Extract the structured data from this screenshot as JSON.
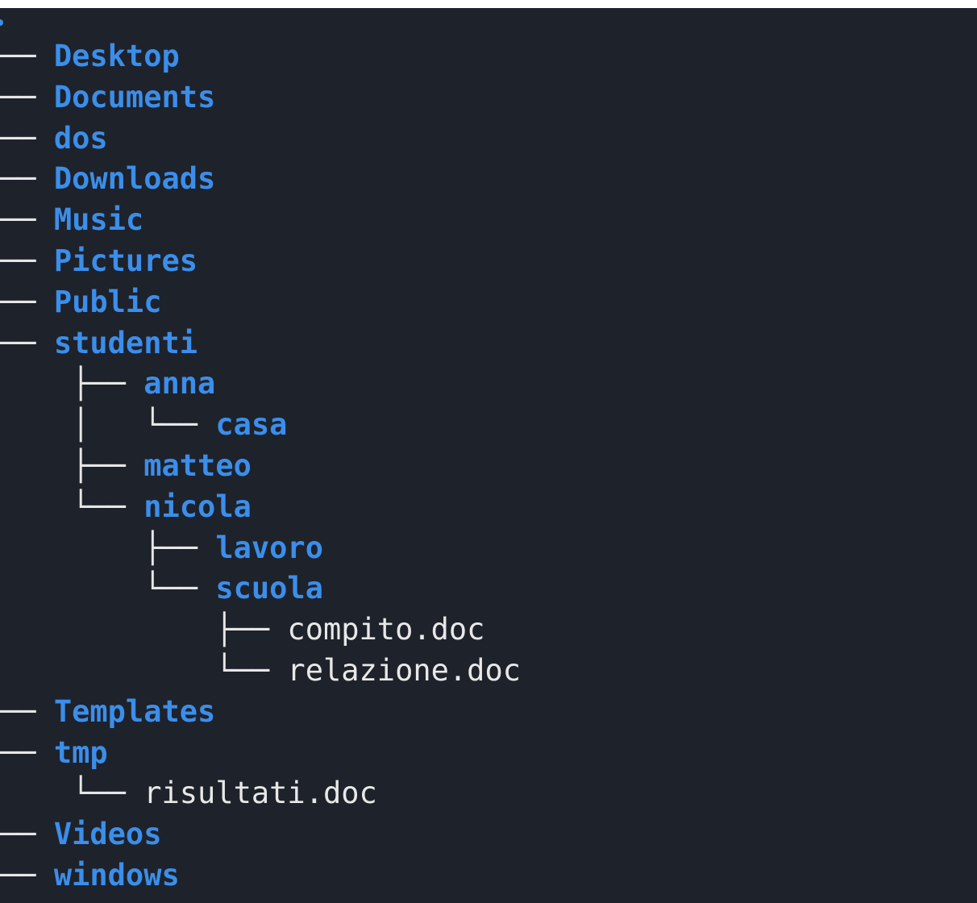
{
  "window": {
    "title": ""
  },
  "colors": {
    "background": "#1e222b",
    "directory": "#3b8eea",
    "file": "#e8e8e8",
    "tree_lines": "#e6e6e6"
  },
  "tree": [
    {
      "prefix": "── ",
      "name": "Desktop",
      "type": "dir"
    },
    {
      "prefix": "── ",
      "name": "Documents",
      "type": "dir"
    },
    {
      "prefix": "── ",
      "name": "dos",
      "type": "dir"
    },
    {
      "prefix": "── ",
      "name": "Downloads",
      "type": "dir"
    },
    {
      "prefix": "── ",
      "name": "Music",
      "type": "dir"
    },
    {
      "prefix": "── ",
      "name": "Pictures",
      "type": "dir"
    },
    {
      "prefix": "── ",
      "name": "Public",
      "type": "dir"
    },
    {
      "prefix": "── ",
      "name": "studenti",
      "type": "dir"
    },
    {
      "prefix": "    ├── ",
      "name": "anna",
      "type": "dir"
    },
    {
      "prefix": "    │   └── ",
      "name": "casa",
      "type": "dir"
    },
    {
      "prefix": "    ├── ",
      "name": "matteo",
      "type": "dir"
    },
    {
      "prefix": "    └── ",
      "name": "nicola",
      "type": "dir"
    },
    {
      "prefix": "        ├── ",
      "name": "lavoro",
      "type": "dir"
    },
    {
      "prefix": "        └── ",
      "name": "scuola",
      "type": "dir"
    },
    {
      "prefix": "            ├── ",
      "name": "compito.doc",
      "type": "file"
    },
    {
      "prefix": "            └── ",
      "name": "relazione.doc",
      "type": "file"
    },
    {
      "prefix": "── ",
      "name": "Templates",
      "type": "dir"
    },
    {
      "prefix": "── ",
      "name": "tmp",
      "type": "dir"
    },
    {
      "prefix": "    └── ",
      "name": "risultati.doc",
      "type": "file"
    },
    {
      "prefix": "── ",
      "name": "Videos",
      "type": "dir"
    },
    {
      "prefix": "── ",
      "name": "windows",
      "type": "dir"
    }
  ]
}
